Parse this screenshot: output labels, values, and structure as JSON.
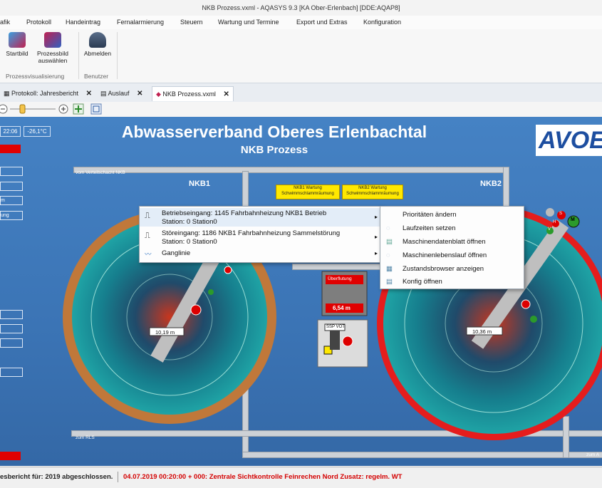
{
  "window": {
    "title": "NKB Prozess.vxml - AQASYS 9.3 [KA Ober-Erlenbach] [DDE:AQAP8]"
  },
  "menu": [
    "afik",
    "Protokoll",
    "Handeintrag",
    "Fernalarmierung",
    "Steuern",
    "Wartung und Termine",
    "Export und Extras",
    "Konfiguration"
  ],
  "ribbon": {
    "group1_label": "Prozessvisualisierung",
    "group2_label": "Benutzer",
    "startbild": "Startbild",
    "prozessbild_line1": "Prozessbild",
    "prozessbild_line2": "auswählen",
    "abmelden": "Abmelden"
  },
  "tabs": [
    {
      "label": "Protokoll: Jahresbericht"
    },
    {
      "label": "Auslauf"
    },
    {
      "label": "NKB Prozess.vxml"
    }
  ],
  "tab_close": "✕",
  "process": {
    "title": "Abwasserverband Oberes Erlenbachtal",
    "subtitle": "NKB Prozess",
    "time": "22:06",
    "temperature": "-26,1°C",
    "logo_text": "AVOE",
    "nkb1_label": "NKB1",
    "nkb2_label": "NKB2",
    "pipe_top_label": "vom Verteilschacht NKB",
    "pipe_bottom_left_label": "zum RLS",
    "pipe_bottom_right_label": "zum A",
    "wartung1_line1": "NKB1 Wartung",
    "wartung1_line2": "Schwimmschlammräumung",
    "wartung2_line1": "NKB2 Wartung",
    "wartung2_line2": "Schwimmschlammräumung",
    "level_nkb1": "10,19 m",
    "level_nkb2": "10,36 m",
    "overflow_label": "Überflutung",
    "shaft_level": "6,54 m",
    "ssp_label": "SSP VOT",
    "left_labels": [
      "m",
      "ung"
    ],
    "status_m": "M",
    "status_h": "H",
    "status_v": "V",
    "status_s": "S"
  },
  "context_menu": {
    "items": [
      {
        "line1": "Betriebseingang: 1145 Fahrbahnheizung NKB1 Betrieb",
        "line2": "Station: 0 Station0"
      },
      {
        "line1": "Störeingang: 1186 NKB1 Fahrbahnheizung Sammelstörung",
        "line2": "Station: 0 Station0"
      },
      {
        "line1": "Ganglinie",
        "line2": ""
      }
    ],
    "submenu_arrow": "▸"
  },
  "submenu": {
    "items": [
      "Prioritäten ändern",
      "Laufzeiten setzen",
      "Maschinendatenblatt öffnen",
      "Maschinenlebenslauf öffnen",
      "Zustandsbrowser anzeigen",
      "Konfig öffnen"
    ]
  },
  "statusbar": {
    "left_text": "esbericht für: 2019 abgeschlossen.",
    "alarm_text": "04.07.2019 00:20:00 + 000:  Zentrale Sichtkontrolle Feinrechen Nord Zusatz: regelm. WT"
  },
  "colors": {
    "canvas_bg": "#3f7abd",
    "alarm_red": "#e00000",
    "warning_yellow": "#ffe800",
    "nkb1_ring": "#c0783a",
    "nkb2_ring": "#e51d1d",
    "tank_teal": "#1fa3a5"
  }
}
